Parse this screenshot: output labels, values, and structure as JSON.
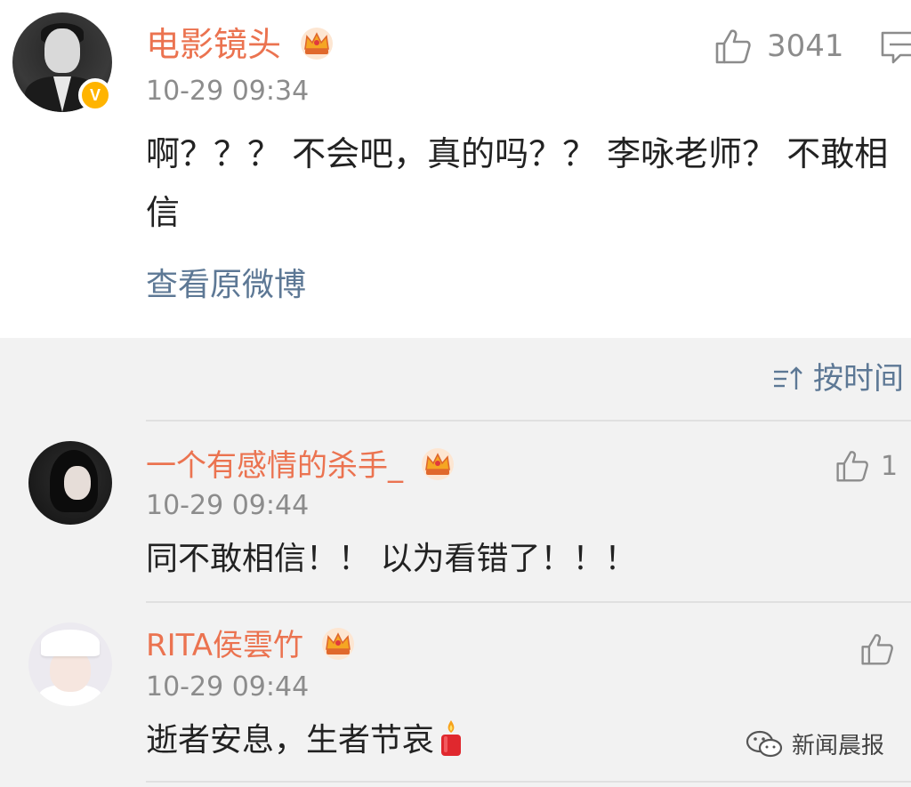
{
  "post": {
    "author": "电影镜头",
    "time": "10-29 09:34",
    "text": "啊？？？ 不会吧，真的吗？？ 李咏老师？ 不敢相信",
    "view_original": "查看原微博",
    "likes": "3041"
  },
  "sort": {
    "label": "按时间"
  },
  "comments": [
    {
      "author": "一个有感情的杀手_",
      "time": "10-29 09:44",
      "text": "同不敢相信！！ 以为看错了！！！",
      "likes": "1"
    },
    {
      "author": "RITA侯雲竹",
      "time": "10-29 09:44",
      "text": "逝者安息，生者节哀",
      "likes": ""
    }
  ],
  "watermark": {
    "text": "新闻晨报"
  },
  "colors": {
    "name": "#eb7350",
    "link": "#5d7895",
    "meta": "#8c8c8c",
    "verified": "#ffb400"
  }
}
